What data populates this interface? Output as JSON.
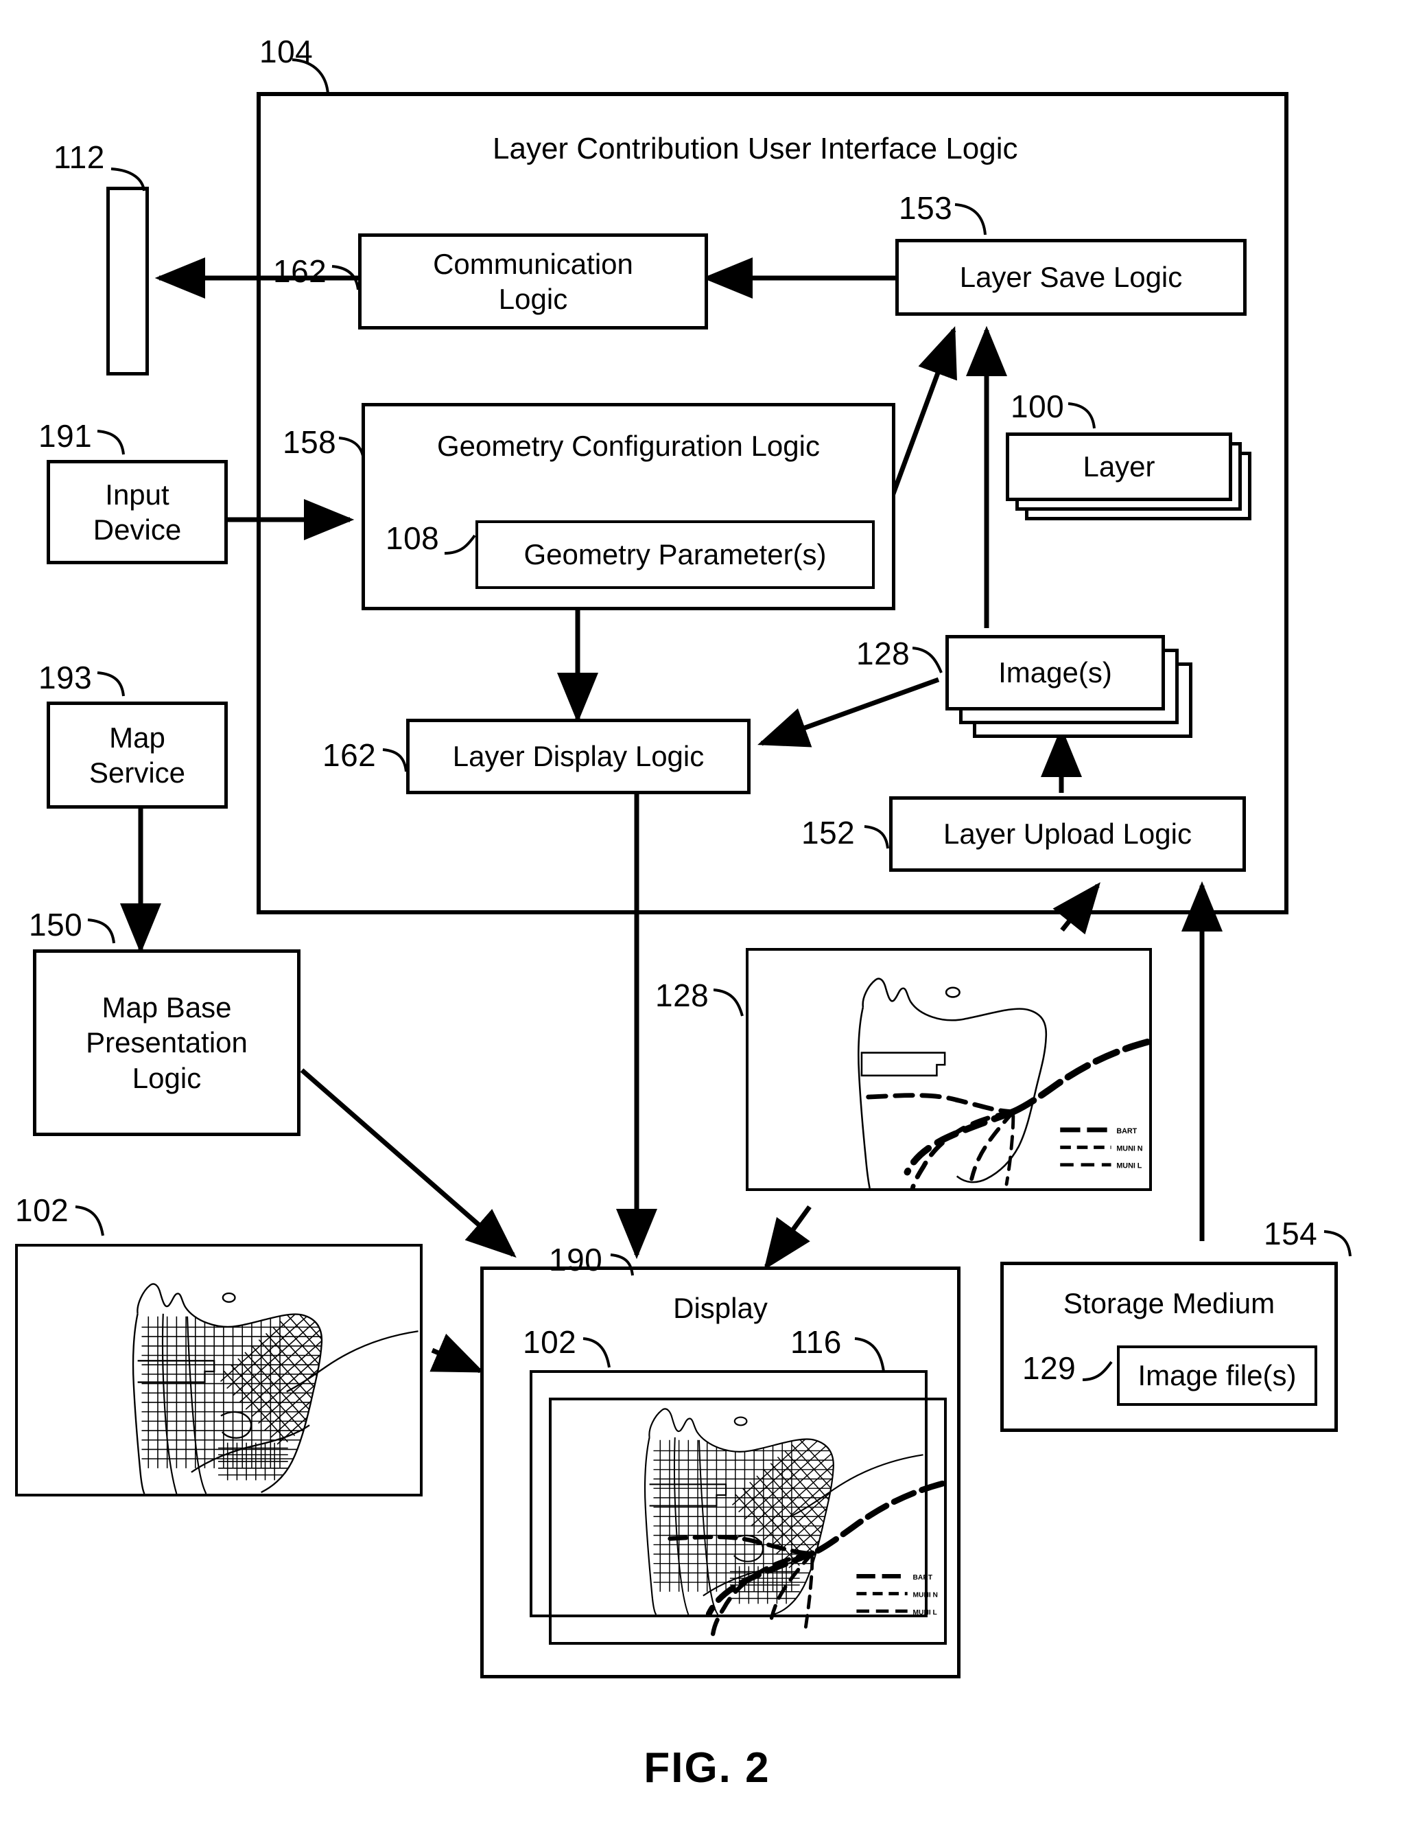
{
  "figure": {
    "caption": "FIG. 2"
  },
  "container": {
    "ref": "104",
    "title": "Layer Contribution User Interface Logic"
  },
  "blocks": {
    "network": {
      "ref": "112",
      "label": ""
    },
    "communication_logic": {
      "ref": "162",
      "label_line1": "Communication",
      "label_line2": "Logic"
    },
    "layer_save_logic": {
      "ref": "153",
      "label": "Layer Save Logic"
    },
    "geometry_configuration_logic": {
      "ref": "158",
      "label": "Geometry Configuration Logic"
    },
    "geometry_parameters": {
      "ref": "108",
      "label": "Geometry Parameter(s)"
    },
    "layer_stack": {
      "ref": "100",
      "label": "Layer"
    },
    "image_stack": {
      "ref": "128",
      "label": "Image(s)"
    },
    "input_device": {
      "ref": "191",
      "label_line1": "Input",
      "label_line2": "Device"
    },
    "map_service": {
      "ref": "193",
      "label_line1": "Map",
      "label_line2": "Service"
    },
    "map_base_presentation_logic": {
      "ref": "150",
      "label_line1": "Map Base",
      "label_line2": "Presentation",
      "label_line3": "Logic"
    },
    "layer_display_logic": {
      "ref": "162",
      "label": "Layer Display Logic"
    },
    "layer_upload_logic": {
      "ref": "152",
      "label": "Layer Upload Logic"
    },
    "storage_medium": {
      "ref": "154",
      "label": "Storage Medium"
    },
    "image_files": {
      "ref": "129",
      "label": "Image file(s)"
    },
    "display": {
      "ref": "190",
      "label": "Display"
    },
    "map_base_image": {
      "ref": "102"
    },
    "layer_image": {
      "ref": "128"
    },
    "display_map_base": {
      "ref": "102"
    },
    "display_layer": {
      "ref": "116"
    }
  },
  "legend": {
    "entries": [
      {
        "name": "BART"
      },
      {
        "name": "MUNI N"
      },
      {
        "name": "MUNI L"
      }
    ]
  },
  "colors": {
    "ink": "#000000",
    "paper": "#ffffff"
  }
}
